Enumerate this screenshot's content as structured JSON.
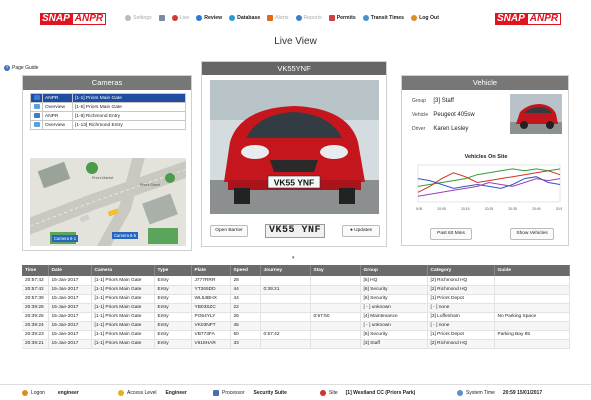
{
  "brand": {
    "part1": "SNAP",
    "part2": "ANPR"
  },
  "nav": {
    "settings": "Settings",
    "live": "Live",
    "review": "Review",
    "database": "Database",
    "alerts": "Alerts",
    "reports": "Reports",
    "permits": "Permits",
    "transit_times": "Transit Times",
    "logout": "Log Out"
  },
  "page_title": "Live View",
  "page_guide": "Page Guide",
  "cameras": {
    "title": "Cameras",
    "items": [
      {
        "type": "ANPR",
        "name": "[1-1] Priors Main Gate",
        "selected": true
      },
      {
        "type": "Overview",
        "name": "[1-5] Priors Main Gate",
        "selected": false
      },
      {
        "type": "ANPR",
        "name": "[1-8] Richmond Entry",
        "selected": false
      },
      {
        "type": "Overview",
        "name": "[1-13] Richmond Entry",
        "selected": false
      }
    ],
    "map_labels": {
      "cam1": "Camera 6-1",
      "cam2": "Camera 6-5",
      "road1": "Priors Market",
      "road2": "Priors Street"
    }
  },
  "camera_view": {
    "plate": "VK55YNF",
    "plate_crop": "VK55 YNF",
    "plate_on_car": "VK55 YNF",
    "open_barrier": "Open Barrier",
    "updates": "Updates"
  },
  "vehicle": {
    "title": "Vehicle",
    "group_label": "Group",
    "group_value": "[3] Staff",
    "vehicle_label": "Vehicle",
    "vehicle_value": "Peugeot 405sw",
    "driver_label": "Driver",
    "driver_value": "Karen Lesley",
    "chart_title": "Vehicles On Site",
    "past_btn": "Past 60 Mins",
    "show_btn": "Show Vehicles"
  },
  "chart_data": {
    "type": "line",
    "title": "Vehicles On Site",
    "x": [
      "19:05",
      "20:00",
      "20:05",
      "20:10",
      "20:15",
      "20:20",
      "20:25",
      "20:30",
      "20:35",
      "20:40",
      "20:45",
      "20:50",
      "20:55"
    ],
    "series": [
      {
        "color": "#2e9e3a",
        "values": [
          8,
          9,
          10,
          11,
          12,
          14,
          15,
          16,
          17,
          16,
          17,
          16,
          17
        ]
      },
      {
        "color": "#d7301f",
        "values": [
          5,
          8,
          12,
          15,
          13,
          10,
          11,
          12,
          13,
          14,
          15,
          16,
          14
        ]
      },
      {
        "color": "#3452c4",
        "values": [
          12,
          11,
          9,
          7,
          8,
          9,
          8,
          7,
          9,
          12,
          13,
          10,
          9
        ]
      },
      {
        "color": "#9b3fb5",
        "values": [
          3,
          4,
          5,
          6,
          7,
          8,
          10,
          9,
          8,
          10,
          12,
          11,
          12
        ]
      }
    ]
  },
  "table": {
    "headers": [
      "Time",
      "Date",
      "Camera",
      "Type",
      "Plate",
      "Speed",
      "Journey",
      "Stay",
      "Group",
      "Category",
      "Guide"
    ],
    "rows": [
      [
        "20:57:42",
        "15-Jan-2017",
        "[1-1] Priors Main Gate",
        "Entry",
        "J777RRR",
        "28",
        "",
        "",
        "[5] HQ",
        "[2] Richmond HQ",
        ""
      ],
      [
        "20:57:42",
        "15-Jan-2017",
        "[1-1] Priors Main Gate",
        "Entry",
        "YT265DD",
        "44",
        "0:39:21",
        "",
        "[6] Security",
        "[2] Richmond HQ",
        ""
      ],
      [
        "20:57:39",
        "15-Jan-2017",
        "[1-1] Priors Main Gate",
        "Entry",
        "WL54BHX",
        "44",
        "",
        "",
        "[6] Security",
        "[1] Priors Depot",
        ""
      ],
      [
        "20:39:28",
        "15-Jan-2017",
        "[1-1] Priors Main Gate",
        "Entry",
        "YB03SZC",
        "22",
        "",
        "",
        "[ - ] unknown",
        "[ - ] none",
        ""
      ],
      [
        "20:39:25",
        "15-Jan-2017",
        "[1-1] Priors Main Gate",
        "Entry",
        "PO54YLY",
        "26",
        "",
        "0:57:50",
        "[4] Maintenance",
        "[3] Luffenham",
        "No Parking Space"
      ],
      [
        "20:39:24",
        "15-Jan-2017",
        "[1-1] Priors Main Gate",
        "Entry",
        "VK03NFT",
        "45",
        "",
        "",
        "[ - ] unknown",
        "[ - ] none",
        ""
      ],
      [
        "20:39:23",
        "15-Jan-2017",
        "[1-1] Priors Main Gate",
        "Entry",
        "VB773FA",
        "50",
        "0:57:42",
        "",
        "[6] Security",
        "[1] Priors Depot",
        "Parking Bay 65"
      ],
      [
        "20:39:21",
        "15-Jan-2017",
        "[1-1] Priors Main Gate",
        "Entry",
        "V618HAR",
        "33",
        "",
        "",
        "[3] Staff",
        "[2] Richmond HQ",
        ""
      ]
    ]
  },
  "status": {
    "logon_label": "Logon",
    "logon_value": "engineer",
    "access_label": "Access Level",
    "access_value": "Engineer",
    "processor_label": "Processor",
    "processor_value": "Security Suite",
    "site_label": "Site",
    "site_value": "[1] Westland CC (Priors Park)",
    "time_label": "System Time",
    "time_value": "20:59 15/01/2017"
  }
}
